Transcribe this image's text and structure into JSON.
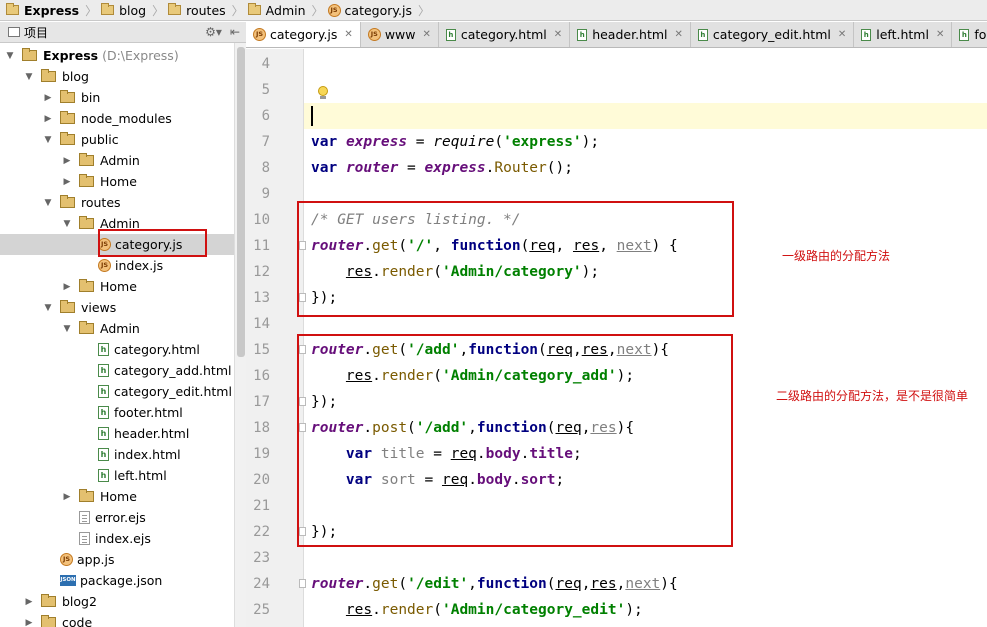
{
  "breadcrumb": [
    "Express",
    "blog",
    "routes",
    "Admin",
    "category.js"
  ],
  "project_panel": {
    "title": "项目"
  },
  "tree": [
    {
      "label": "Express",
      "extra": "(D:\\Express)",
      "depth": 0,
      "type": "folder",
      "open": true,
      "bold": true
    },
    {
      "label": "blog",
      "depth": 1,
      "type": "folder",
      "open": true
    },
    {
      "label": "bin",
      "depth": 2,
      "type": "folder",
      "open": false
    },
    {
      "label": "node_modules",
      "depth": 2,
      "type": "folder",
      "open": false
    },
    {
      "label": "public",
      "depth": 2,
      "type": "folder",
      "open": true
    },
    {
      "label": "Admin",
      "depth": 3,
      "type": "folder",
      "open": false
    },
    {
      "label": "Home",
      "depth": 3,
      "type": "folder",
      "open": false
    },
    {
      "label": "routes",
      "depth": 2,
      "type": "folder",
      "open": true
    },
    {
      "label": "Admin",
      "depth": 3,
      "type": "folder",
      "open": true
    },
    {
      "label": "category.js",
      "depth": 4,
      "type": "js",
      "selected": true
    },
    {
      "label": "index.js",
      "depth": 4,
      "type": "js"
    },
    {
      "label": "Home",
      "depth": 3,
      "type": "folder",
      "open": false
    },
    {
      "label": "views",
      "depth": 2,
      "type": "folder",
      "open": true
    },
    {
      "label": "Admin",
      "depth": 3,
      "type": "folder",
      "open": true
    },
    {
      "label": "category.html",
      "depth": 4,
      "type": "html"
    },
    {
      "label": "category_add.html",
      "depth": 4,
      "type": "html"
    },
    {
      "label": "category_edit.html",
      "depth": 4,
      "type": "html"
    },
    {
      "label": "footer.html",
      "depth": 4,
      "type": "html"
    },
    {
      "label": "header.html",
      "depth": 4,
      "type": "html"
    },
    {
      "label": "index.html",
      "depth": 4,
      "type": "html"
    },
    {
      "label": "left.html",
      "depth": 4,
      "type": "html"
    },
    {
      "label": "Home",
      "depth": 3,
      "type": "folder",
      "open": false
    },
    {
      "label": "error.ejs",
      "depth": 3,
      "type": "ejs"
    },
    {
      "label": "index.ejs",
      "depth": 3,
      "type": "ejs"
    },
    {
      "label": "app.js",
      "depth": 2,
      "type": "js"
    },
    {
      "label": "package.json",
      "depth": 2,
      "type": "json"
    },
    {
      "label": "blog2",
      "depth": 1,
      "type": "folder",
      "open": false
    },
    {
      "label": "code",
      "depth": 1,
      "type": "folder",
      "open": false
    }
  ],
  "tabs": [
    {
      "label": "category.js",
      "type": "js",
      "active": true
    },
    {
      "label": "www",
      "type": "js"
    },
    {
      "label": "category.html",
      "type": "html"
    },
    {
      "label": "header.html",
      "type": "html"
    },
    {
      "label": "category_edit.html",
      "type": "html"
    },
    {
      "label": "left.html",
      "type": "html"
    },
    {
      "label": "foot",
      "type": "html"
    }
  ],
  "line_numbers": [
    "4",
    "5",
    "6",
    "7",
    "8",
    "9",
    "10",
    "11",
    "12",
    "13",
    "14",
    "15",
    "16",
    "17",
    "18",
    "19",
    "20",
    "21",
    "22",
    "23",
    "24",
    "25"
  ],
  "annotations": {
    "first_level": "一级路由的分配方法",
    "second_level": "二级路由的分配方法，是不是很简单"
  },
  "colors": {
    "annotation_red": "#d01010",
    "keyword": "#000080",
    "string": "#008000",
    "comment": "#808080"
  }
}
